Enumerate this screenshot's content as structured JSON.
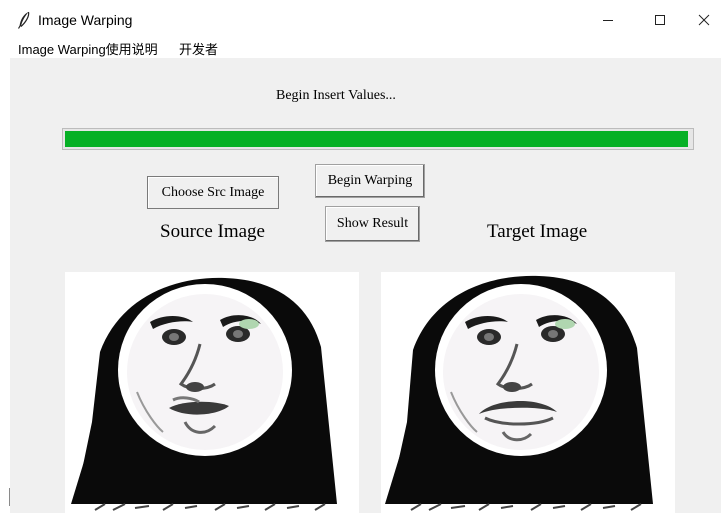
{
  "window": {
    "title": "Image Warping",
    "icon": "feather-icon",
    "controls": [
      "minimize-icon",
      "maximize-icon",
      "close-icon"
    ]
  },
  "menu": {
    "items": [
      "Image Warping使用说明",
      "开发者"
    ]
  },
  "status": {
    "text": "Begin Insert Values...",
    "progress_fraction": 0.995,
    "progress_color": "#06b025"
  },
  "buttons": {
    "choose_src": "Choose Src Image",
    "begin_warping": "Begin Warping",
    "show_result": "Show Result"
  },
  "labels": {
    "source": "Source Image",
    "target": "Target Image"
  },
  "images": {
    "source": "face-meme-image",
    "target": "warped-face-meme-image"
  }
}
